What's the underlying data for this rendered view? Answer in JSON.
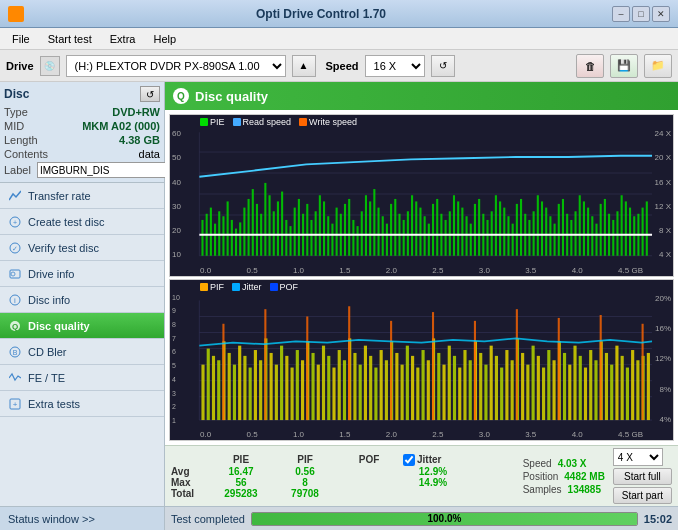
{
  "titleBar": {
    "title": "Opti Drive Control 1.70",
    "minimize": "–",
    "maximize": "□",
    "close": "✕",
    "iconColor": "#ff8800"
  },
  "menuBar": {
    "items": [
      "File",
      "Start test",
      "Extra",
      "Help"
    ]
  },
  "driveBar": {
    "driveLabel": "Drive",
    "driveValue": "(H:)  PLEXTOR DVDR  PX-890SA 1.00",
    "speedLabel": "Speed",
    "speedValue": "16 X"
  },
  "sidebar": {
    "disc": {
      "title": "Disc",
      "type_label": "Type",
      "type_value": "DVD+RW",
      "mid_label": "MID",
      "mid_value": "MKM A02 (000)",
      "length_label": "Length",
      "length_value": "4.38 GB",
      "contents_label": "Contents",
      "contents_value": "data",
      "label_label": "Label",
      "label_value": "IMGBURN_DIS"
    },
    "navItems": [
      {
        "id": "transfer-rate",
        "label": "Transfer rate",
        "active": false
      },
      {
        "id": "create-test-disc",
        "label": "Create test disc",
        "active": false
      },
      {
        "id": "verify-test-disc",
        "label": "Verify test disc",
        "active": false
      },
      {
        "id": "drive-info",
        "label": "Drive info",
        "active": false
      },
      {
        "id": "disc-info",
        "label": "Disc info",
        "active": false
      },
      {
        "id": "disc-quality",
        "label": "Disc quality",
        "active": true
      },
      {
        "id": "cd-bler",
        "label": "CD Bler",
        "active": false
      },
      {
        "id": "fe-te",
        "label": "FE / TE",
        "active": false
      },
      {
        "id": "extra-tests",
        "label": "Extra tests",
        "active": false
      }
    ],
    "statusWindow": "Status window >>"
  },
  "discQuality": {
    "title": "Disc quality",
    "chart1": {
      "legend": [
        {
          "color": "#00dd00",
          "label": "PIE"
        },
        {
          "color": "#44aaff",
          "label": "Read speed"
        },
        {
          "color": "#ff6600",
          "label": "Write speed"
        }
      ],
      "yAxisLeft": [
        "60",
        "50",
        "40",
        "30",
        "20",
        "10"
      ],
      "yAxisRight": [
        "24 X",
        "20 X",
        "16 X",
        "12 X",
        "8 X",
        "4 X"
      ],
      "xAxis": [
        "0.0",
        "0.5",
        "1.0",
        "1.5",
        "2.0",
        "2.5",
        "3.0",
        "3.5",
        "4.0",
        "4.5 GB"
      ]
    },
    "chart2": {
      "legend": [
        {
          "color": "#ffaa00",
          "label": "PIF"
        },
        {
          "color": "#00aaff",
          "label": "Jitter"
        },
        {
          "color": "#0044ff",
          "label": "POF"
        }
      ],
      "yAxisLeft": [
        "10",
        "9",
        "8",
        "7",
        "6",
        "5",
        "4",
        "3",
        "2",
        "1"
      ],
      "yAxisRight": [
        "20%",
        "16%",
        "12%",
        "8%",
        "4%"
      ],
      "xAxis": [
        "0.0",
        "0.5",
        "1.0",
        "1.5",
        "2.0",
        "2.5",
        "3.0",
        "3.5",
        "4.0",
        "4.5 GB"
      ]
    }
  },
  "stats": {
    "headers": [
      "",
      "PIE",
      "PIF",
      "POF",
      "Jitter"
    ],
    "avg": {
      "label": "Avg",
      "pie": "16.47",
      "pif": "0.56",
      "pof": "",
      "jitter": "12.9%"
    },
    "max": {
      "label": "Max",
      "pie": "56",
      "pif": "8",
      "pof": "",
      "jitter": "14.9%"
    },
    "total": {
      "label": "Total",
      "pie": "295283",
      "pif": "79708",
      "pof": "",
      "jitter": ""
    },
    "jitterChecked": true,
    "speed": {
      "speedLabel": "Speed",
      "speedValue": "4.03 X",
      "positionLabel": "Position",
      "positionValue": "4482 MB",
      "samplesLabel": "Samples",
      "samplesValue": "134885"
    },
    "speedSelect": "4 X",
    "startFull": "Start full",
    "startPart": "Start part"
  },
  "progressBar": {
    "label": "Test completed",
    "percent": 100,
    "percentText": "100.0%",
    "time": "15:02"
  }
}
